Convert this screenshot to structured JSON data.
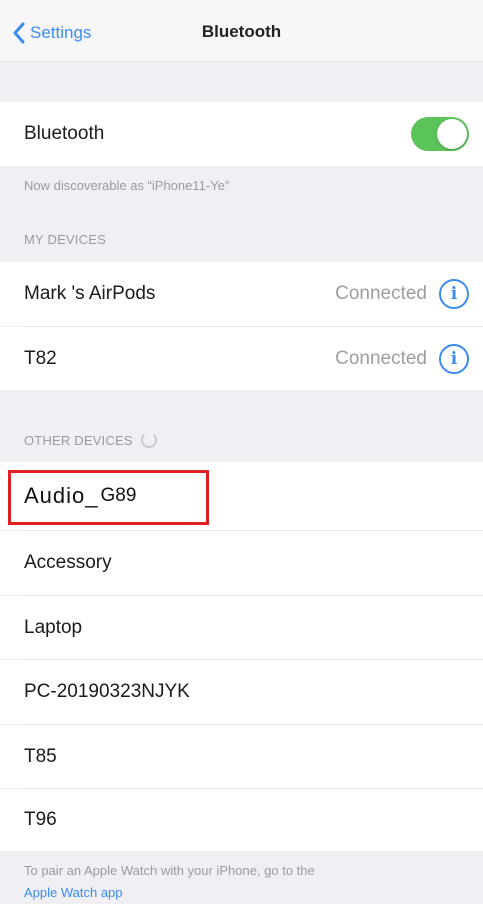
{
  "nav": {
    "back_label": "Settings",
    "title": "Bluetooth"
  },
  "bluetooth": {
    "label": "Bluetooth",
    "enabled": true,
    "discoverable_note": "Now discoverable as “iPhone11-Ye”"
  },
  "my_devices": {
    "header": "MY DEVICES",
    "items": [
      {
        "name": "Mark 's AirPods",
        "status": "Connected"
      },
      {
        "name": "T82",
        "status": "Connected"
      }
    ]
  },
  "other_devices": {
    "header": "OTHER DEVICES",
    "items": [
      {
        "name_main": "Audio_",
        "name_suffix": "G89"
      },
      {
        "name": "Accessory"
      },
      {
        "name": "Laptop"
      },
      {
        "name": "PC-20190323NJYK"
      },
      {
        "name": "T85"
      },
      {
        "name": "T96"
      }
    ]
  },
  "footer": {
    "text": "To pair an Apple Watch with your iPhone, go to the",
    "link": "Apple Watch app"
  },
  "colors": {
    "accent": "#3a8cf2",
    "toggle_on": "#5ac35a",
    "highlight_box": "#e02020"
  },
  "icons": {
    "back": "chevron-left-icon",
    "info": "info-circle-icon",
    "spinner": "loading-spinner-icon"
  }
}
